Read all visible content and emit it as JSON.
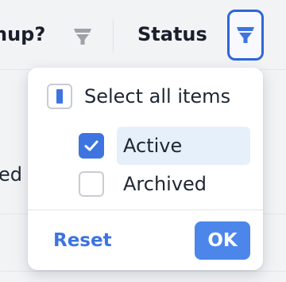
{
  "table_header": {
    "columns": [
      {
        "title": "nup?",
        "filter_active": false
      },
      {
        "title": "Status",
        "filter_active": true
      }
    ]
  },
  "table_body": {
    "visible_cell_text": "ed"
  },
  "status_filter_dropdown": {
    "select_all": {
      "label": "Select all items",
      "state": "indeterminate"
    },
    "options": [
      {
        "label": "Active",
        "checked": true,
        "highlighted": true
      },
      {
        "label": "Archived",
        "checked": false,
        "highlighted": false
      }
    ],
    "reset_label": "Reset",
    "ok_label": "OK"
  },
  "colors": {
    "accent": "#3d74e0",
    "ok_button": "#4d86ea",
    "active_filter_border": "#2f66d8",
    "highlight_row": "#e6f0fb",
    "inactive_filter_icon": "#9ea2a8"
  },
  "icons": {
    "column_filter": "filter-funnel-icon",
    "checkbox_checked": "checkmark-icon",
    "checkbox_indeterminate": "indeterminate-bar-icon"
  }
}
